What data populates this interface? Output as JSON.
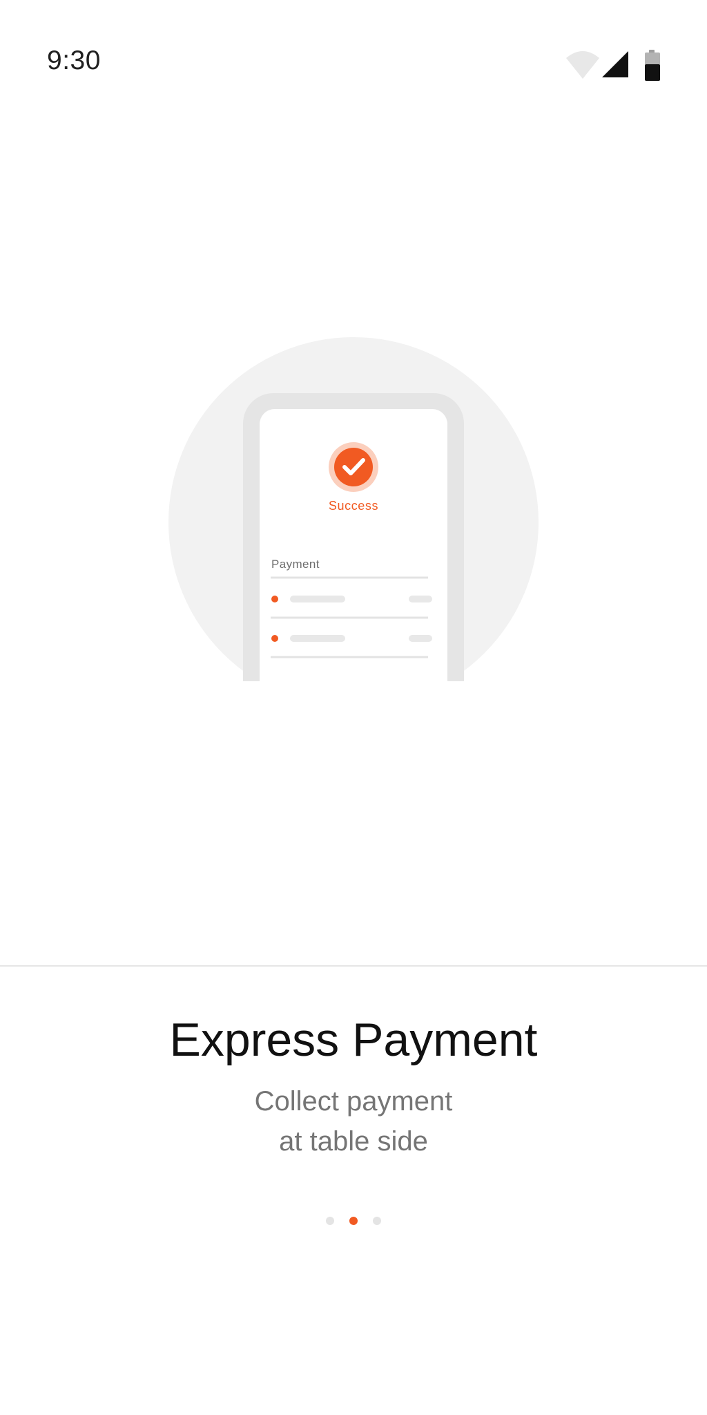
{
  "status_bar": {
    "time": "9:30",
    "icons": [
      "wifi-icon",
      "cellular-signal-icon",
      "battery-icon"
    ]
  },
  "illustration": {
    "success_label": "Success",
    "payment_label": "Payment",
    "accent_color": "#f15a22"
  },
  "onboarding": {
    "title": "Express Payment",
    "subtitle_line1": "Collect payment",
    "subtitle_line2": "at table side",
    "page_count": 3,
    "active_page": 2
  },
  "colors": {
    "accent": "#f15a22",
    "title": "#111111",
    "subtitle": "#757575",
    "illustration_bg": "#f2f2f2"
  }
}
